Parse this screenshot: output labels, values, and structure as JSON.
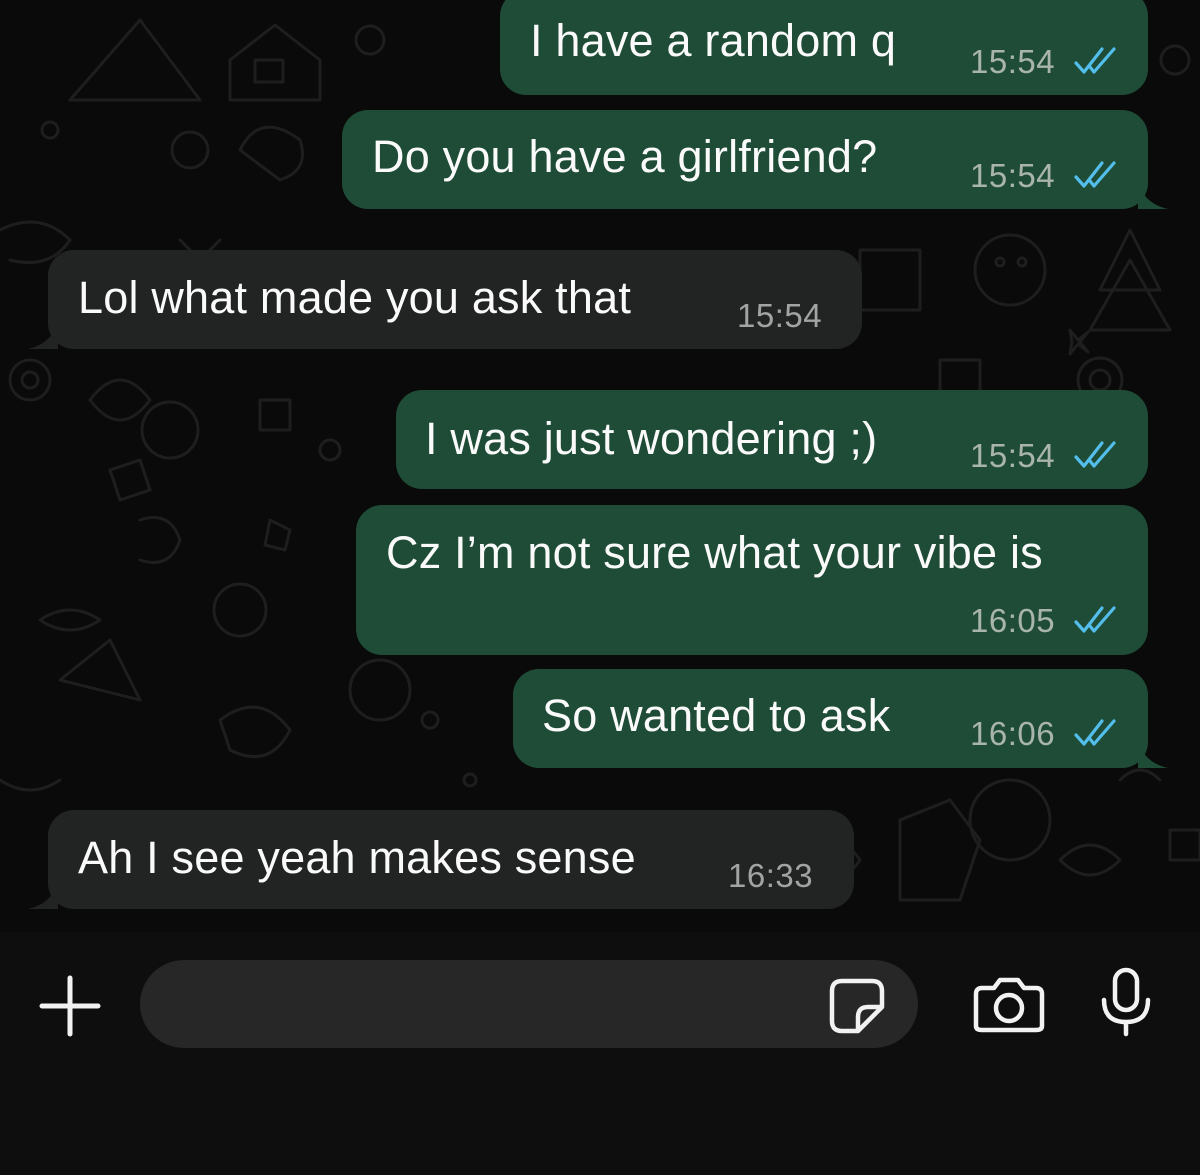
{
  "messages": [
    {
      "direction": "outgoing",
      "text": "I have a random q",
      "time": "15:54",
      "read": true
    },
    {
      "direction": "outgoing",
      "text": "Do you have a girlfriend?",
      "time": "15:54",
      "read": true
    },
    {
      "direction": "incoming",
      "text": "Lol what made you ask that",
      "time": "15:54"
    },
    {
      "direction": "outgoing",
      "text": "I was just wondering ;)",
      "time": "15:54",
      "read": true
    },
    {
      "direction": "outgoing",
      "text": "Cz I’m not sure what your vibe is",
      "time": "16:05",
      "read": true
    },
    {
      "direction": "outgoing",
      "text": "So wanted to ask",
      "time": "16:06",
      "read": true
    },
    {
      "direction": "incoming",
      "text": "Ah I see yeah makes sense",
      "time": "16:33"
    }
  ],
  "composer": {
    "attach_icon": "plus-icon",
    "sticker_icon": "sticker-icon",
    "camera_icon": "camera-icon",
    "mic_icon": "microphone-icon",
    "input_value": ""
  },
  "colors": {
    "outgoing_bubble": "#1f4c36",
    "incoming_bubble": "#222423",
    "read_ticks": "#53bdeb"
  }
}
